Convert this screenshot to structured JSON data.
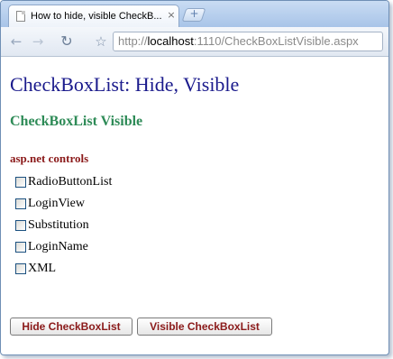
{
  "browser": {
    "tab_title": "How to hide, visible CheckB...",
    "tab_close": "×",
    "new_tab": "+",
    "url_scheme": "http://",
    "url_host": "localhost",
    "url_path": ":1110/CheckBoxListVisible.aspx",
    "back_glyph": "←",
    "forward_glyph": "→",
    "reload_glyph": "↻",
    "star_glyph": "☆"
  },
  "page": {
    "title": "CheckBoxList: Hide, Visible",
    "subtitle": "CheckBoxList Visible",
    "list_heading": "asp.net controls",
    "items": [
      {
        "label": "RadioButtonList",
        "checked": false
      },
      {
        "label": "LoginView",
        "checked": false
      },
      {
        "label": "Substitution",
        "checked": false
      },
      {
        "label": "LoginName",
        "checked": false
      },
      {
        "label": "XML",
        "checked": false
      }
    ],
    "hide_button": "Hide CheckBoxList",
    "visible_button": "Visible CheckBoxList"
  },
  "colors": {
    "title": "#1a1a8c",
    "subtitle": "#2e8b57",
    "heading": "#8b1a1a",
    "button_text": "#8b1a1a"
  }
}
